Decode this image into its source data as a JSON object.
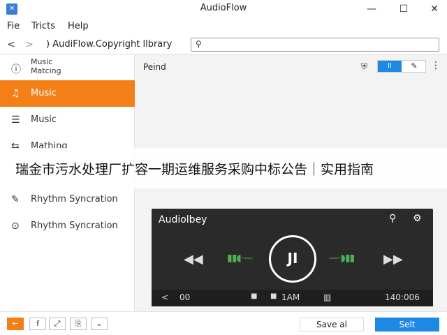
{
  "window": {
    "title": "AudioFlow",
    "controls": {
      "minimize": "—",
      "maximize": "☐",
      "close": "✕"
    }
  },
  "menu": [
    "Fie",
    "Tricts",
    "Help"
  ],
  "nav": {
    "back": "<",
    "forward": ">",
    "path": ") AudiFlow.Copyright llbrary",
    "search_value": ""
  },
  "sidebar": {
    "items": [
      {
        "label": "Music Matcing",
        "icon": "info-icon",
        "glyph": "ⓘ"
      },
      {
        "label": "Music",
        "icon": "music-note-icon",
        "glyph": "♫",
        "active": true
      },
      {
        "label": "Music",
        "icon": "list-icon",
        "glyph": "☰"
      },
      {
        "label": "Mathing",
        "icon": "match-icon",
        "glyph": "⇆"
      },
      {
        "label": "",
        "icon": "unknown-icon",
        "glyph": ""
      },
      {
        "label": "Rhythm Syncration",
        "icon": "link-icon",
        "glyph": "✎"
      },
      {
        "label": "Rhythm Syncration",
        "icon": "rhythm-icon",
        "glyph": "⊙"
      }
    ]
  },
  "content": {
    "header": "Peind",
    "view_toggle": {
      "grid": "II",
      "edit": "✎"
    }
  },
  "banner": {
    "text": "瑞金市污水处理厂扩容一期运维服务采购中标公告｜实用指南"
  },
  "player": {
    "title": "Audiolbey",
    "icons": {
      "search": "⚲",
      "settings": "⚙"
    },
    "play_glyph": "JI",
    "bottom": {
      "prev": "<",
      "time_start": "00",
      "block1": "■",
      "block2": "■",
      "time_mid": "1AM",
      "block3": "▥",
      "time_end": "140:006"
    }
  },
  "footer": {
    "buttons": [
      "←",
      "f",
      "⤢",
      "⎘",
      "⌄"
    ],
    "save_all": "Save al",
    "set": "Selt"
  },
  "colors": {
    "accent": "#f57f17",
    "primary": "#1e88e5",
    "player_bg": "#2a2a2a",
    "wave": "#4caf50"
  }
}
